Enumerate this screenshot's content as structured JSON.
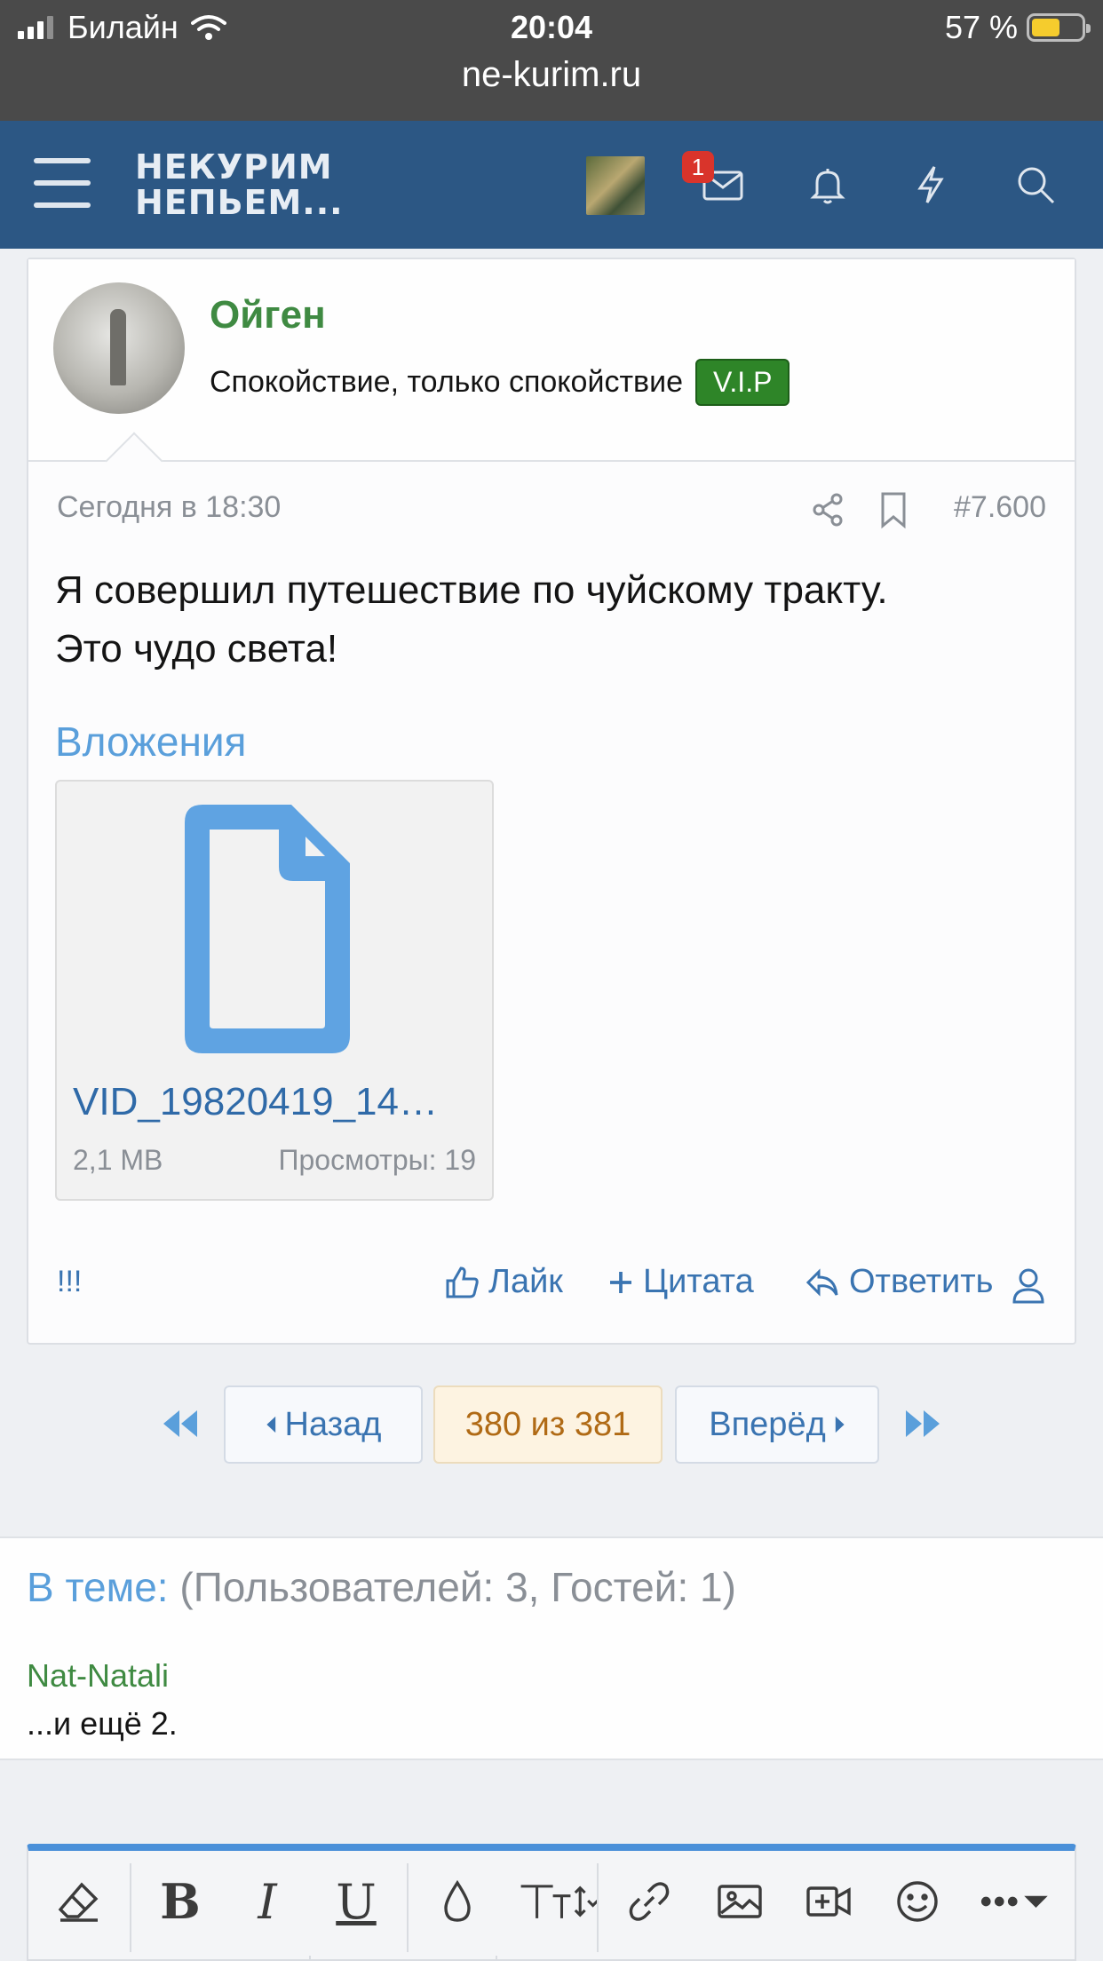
{
  "status_bar": {
    "carrier": "Билайн",
    "time": "20:04",
    "battery_text": "57 %",
    "battery_level": 0.57,
    "url": "ne-kurim.ru"
  },
  "header": {
    "logo_line1": "НЕКУРИМ",
    "logo_line2": "НЕПЬЕМ...",
    "inbox_badge": "1"
  },
  "post": {
    "author": "Ойген",
    "user_title": "Спокойствие, только спокойствие",
    "user_badge": "V.I.P",
    "date": "Сегодня в 18:30",
    "post_number": "#7.600",
    "text_line1": "Я совершил путешествие по чуйскому тракту.",
    "text_line2": "Это чудо света!",
    "attachments_title": "Вложения",
    "attachment": {
      "filename": "VID_19820419_14…",
      "size": "2,1 MB",
      "views": "Просмотры: 19"
    },
    "actions": {
      "report": "!!!",
      "like": "Лайк",
      "quote": "Цитата",
      "reply": "Ответить"
    }
  },
  "pagination": {
    "prev": "Назад",
    "current": "380 из 381",
    "next": "Вперёд"
  },
  "online": {
    "label": "В теме:",
    "counts": "(Пользователей: 3, Гостей: 1)",
    "user": "Nat-Natali",
    "more": "...и ещё 2."
  },
  "colors": {
    "header_bg": "#2c5784",
    "accent_blue": "#3a74b1",
    "username_green": "#3f8a42",
    "vip_green": "#2e8528",
    "editor_accent": "#4a90d9"
  }
}
